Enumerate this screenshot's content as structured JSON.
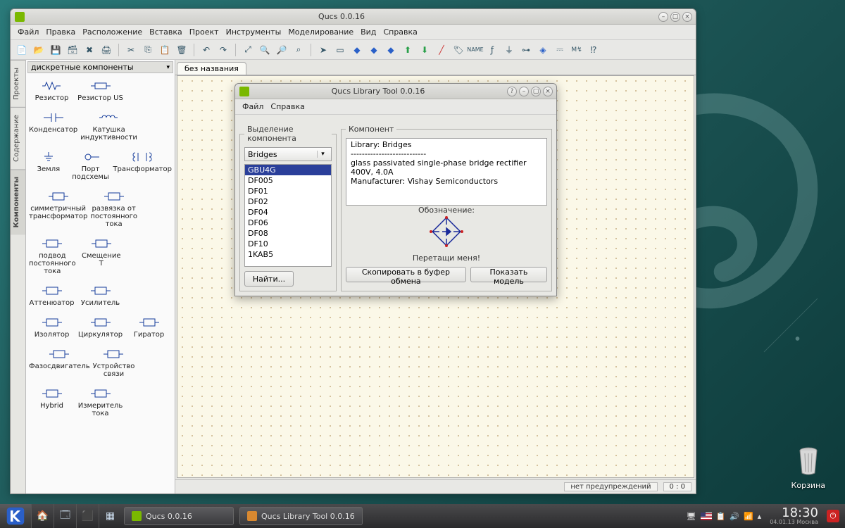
{
  "desktop": {
    "trash_label": "Корзина"
  },
  "main_window": {
    "title": "Qucs 0.0.16",
    "menu": [
      "Файл",
      "Правка",
      "Расположение",
      "Вставка",
      "Проект",
      "Инструменты",
      "Моделирование",
      "Вид",
      "Справка"
    ],
    "side_tabs": [
      "Проекты",
      "Содержание",
      "Компоненты"
    ],
    "active_side_tab": 2,
    "category_label": "дискретные компоненты",
    "components": [
      [
        "Резистор",
        "Резистор US",
        ""
      ],
      [
        "Конденсатор",
        "Катушка индуктивности",
        ""
      ],
      [
        "Земля",
        "Порт подсхемы",
        "Трансформатор"
      ],
      [
        "симметричный трансформатор",
        "развязка от постоянного тока",
        ""
      ],
      [
        "подвод постоянного тока",
        "Смещение Т",
        ""
      ],
      [
        "Аттенюатор",
        "Усилитель",
        ""
      ],
      [
        "Изолятор",
        "Циркулятор",
        "Гиратор"
      ],
      [
        "Фазосдвигатель",
        "Устройство связи",
        ""
      ],
      [
        "Hybrid",
        "Измеритель тока",
        ""
      ]
    ],
    "doc_tab": "без названия",
    "status": {
      "warnings": "нет предупреждений",
      "coords": "0 : 0"
    }
  },
  "library_dialog": {
    "title": "Qucs Library Tool 0.0.16",
    "menu": [
      "Файл",
      "Справка"
    ],
    "group_left": "Выделение компонента",
    "group_right": "Компонент",
    "combo_value": "Bridges",
    "list_items": [
      "GBU4G",
      "DF005",
      "DF01",
      "DF02",
      "DF04",
      "DF06",
      "DF08",
      "DF10",
      "1KAB5"
    ],
    "selected_index": 0,
    "find_button": "Найти...",
    "desc_lines": [
      "Library: Bridges",
      "---------------------------",
      "glass passivated single-phase bridge rectifier",
      "400V, 4.0A",
      "Manufacturer: Vishay Semiconductors"
    ],
    "symbol_caption": "Обозначение:",
    "drag_hint": "Перетащи меня!",
    "btn_copy": "Скопировать в буфер обмена",
    "btn_model": "Показать модель"
  },
  "taskbar": {
    "task1": "Qucs 0.0.16",
    "task2": "Qucs Library Tool 0.0.16",
    "time": "18:30",
    "date": "04.01.13 Москва"
  }
}
